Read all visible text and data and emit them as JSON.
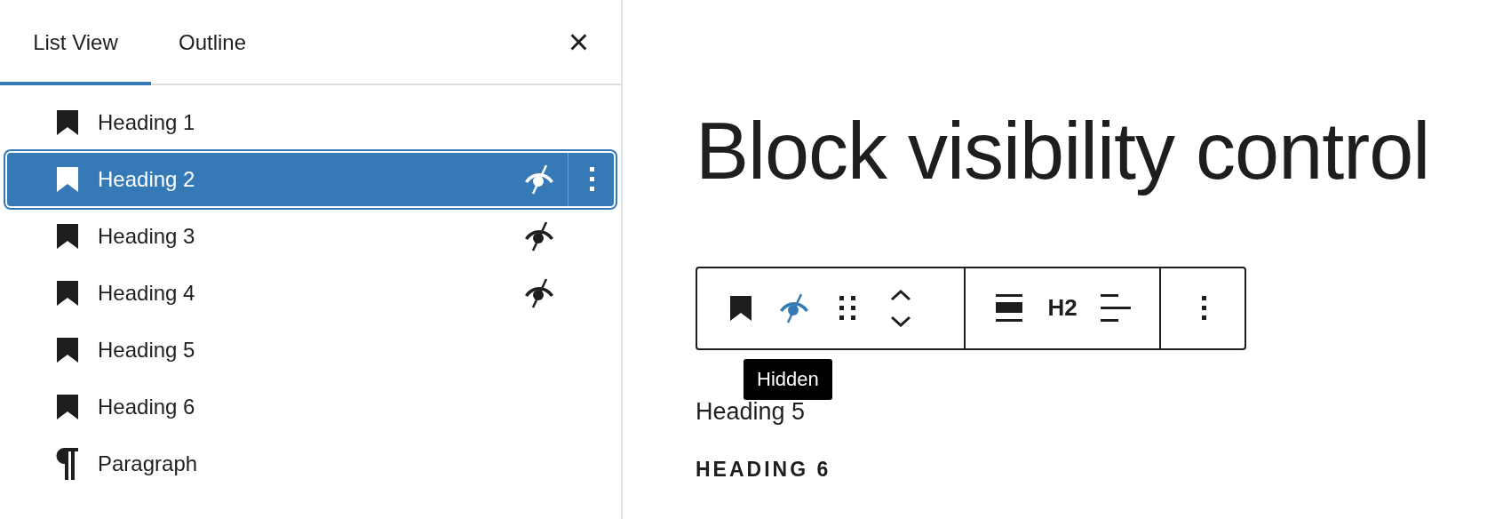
{
  "sidebar": {
    "tabs": [
      {
        "label": "List View",
        "selected": true
      },
      {
        "label": "Outline",
        "selected": false
      }
    ],
    "close_label": "×",
    "items": [
      {
        "kind": "heading",
        "label": "Heading 1",
        "selected": false,
        "hidden": false
      },
      {
        "kind": "heading",
        "label": "Heading 2",
        "selected": true,
        "hidden": true
      },
      {
        "kind": "heading",
        "label": "Heading 3",
        "selected": false,
        "hidden": true
      },
      {
        "kind": "heading",
        "label": "Heading 4",
        "selected": false,
        "hidden": true
      },
      {
        "kind": "heading",
        "label": "Heading 5",
        "selected": false,
        "hidden": false
      },
      {
        "kind": "heading",
        "label": "Heading 6",
        "selected": false,
        "hidden": false
      },
      {
        "kind": "paragraph",
        "label": "Paragraph",
        "selected": false,
        "hidden": false
      }
    ]
  },
  "editor": {
    "title": "Block visibility control",
    "toolbar": {
      "groups": [
        [
          {
            "kind": "block",
            "active": false
          },
          {
            "kind": "visibility",
            "active": true
          },
          {
            "kind": "drag",
            "active": false
          },
          {
            "kind": "move",
            "active": false
          }
        ],
        [
          {
            "kind": "align",
            "active": false
          },
          {
            "kind": "level",
            "label": "H2",
            "active": false
          },
          {
            "kind": "text-align",
            "active": false
          }
        ],
        [
          {
            "kind": "more",
            "active": false
          }
        ]
      ],
      "tooltip": "Hidden"
    },
    "blocks": [
      {
        "kind": "heading-5",
        "text": "Heading 5"
      },
      {
        "kind": "heading-6",
        "text": "HEADING 6"
      }
    ]
  }
}
